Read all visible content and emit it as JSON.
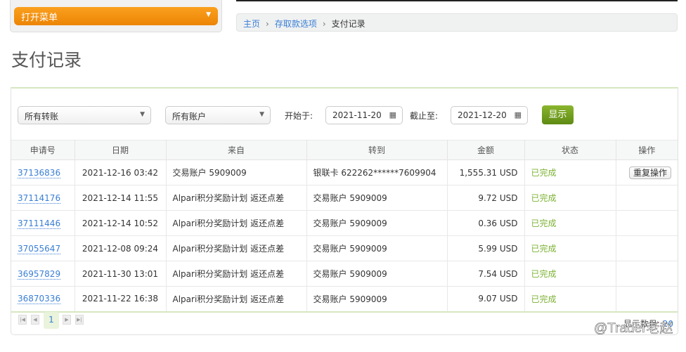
{
  "menu": {
    "label": "打开菜单"
  },
  "breadcrumb": {
    "items": [
      "主页",
      "存取款选项"
    ],
    "current": "支付记录"
  },
  "title": "支付记录",
  "filters": {
    "transfer_type": "所有转账",
    "account": "所有账户",
    "start_label": "开始于:",
    "start_date": "2021-11-20",
    "end_label": "截止至:",
    "end_date": "2021-12-20",
    "show_label": "显示"
  },
  "table": {
    "headers": [
      "申请号",
      "日期",
      "来自",
      "转到",
      "金额",
      "状态",
      "操作"
    ],
    "rows": [
      {
        "id": "37136836",
        "date": "2021-12-16 03:42",
        "from": "交易账户 5909009",
        "to": "银联卡 622262******7609904",
        "amount": "1,555.31 USD",
        "status": "已完成",
        "action": "重复操作"
      },
      {
        "id": "37114176",
        "date": "2021-12-14 11:55",
        "from": "Alpari积分奖励计划 返还点差",
        "to": "交易账户 5909009",
        "amount": "9.72 USD",
        "status": "已完成"
      },
      {
        "id": "37111446",
        "date": "2021-12-14 10:52",
        "from": "Alpari积分奖励计划 返还点差",
        "to": "交易账户 5909009",
        "amount": "0.36 USD",
        "status": "已完成"
      },
      {
        "id": "37055647",
        "date": "2021-12-08 09:24",
        "from": "Alpari积分奖励计划 返还点差",
        "to": "交易账户 5909009",
        "amount": "5.99 USD",
        "status": "已完成"
      },
      {
        "id": "36957829",
        "date": "2021-11-30 13:01",
        "from": "Alpari积分奖励计划 返还点差",
        "to": "交易账户 5909009",
        "amount": "7.54 USD",
        "status": "已完成"
      },
      {
        "id": "36870336",
        "date": "2021-11-22 16:38",
        "from": "Alpari积分奖励计划 返还点差",
        "to": "交易账户 5909009",
        "amount": "9.07 USD",
        "status": "已完成"
      }
    ]
  },
  "pagination": {
    "current": "1",
    "count_label": "显示数目:",
    "count": "20"
  },
  "watermark": "@Trader老赵"
}
